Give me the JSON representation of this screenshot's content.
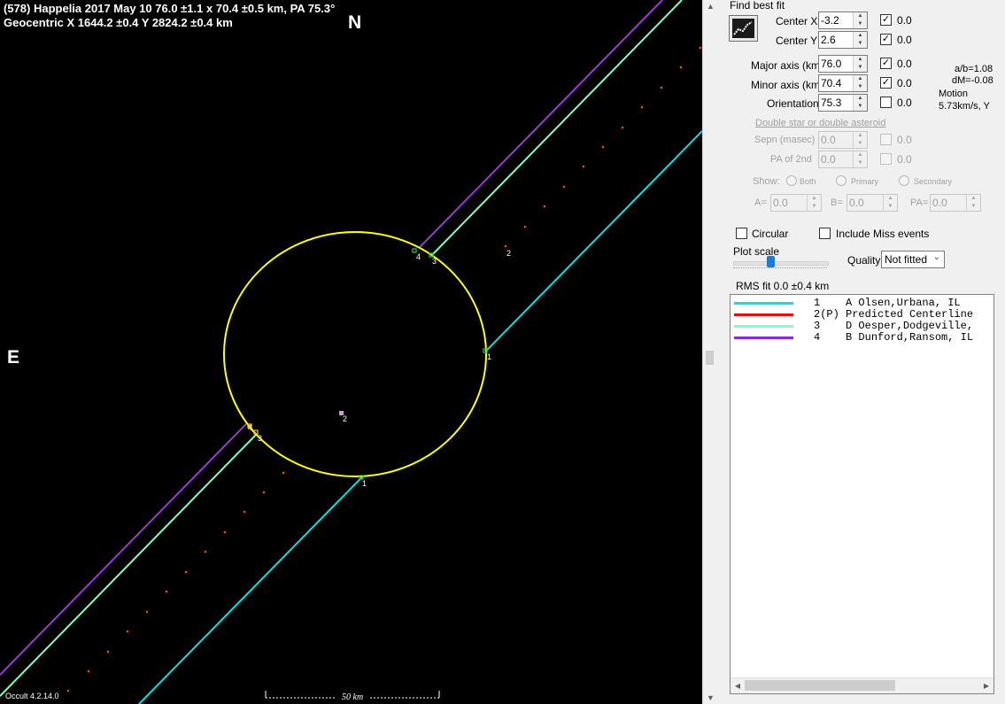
{
  "plot": {
    "title_line1": "(578) Happelia  2017 May 10   76.0 ±1.1 x 70.4 ±0.5 km,  PA 75.3°",
    "title_line2": "Geocentric  X  1644.2 ±0.4  Y 2824.2 ±0.4 km",
    "north_label": "N",
    "east_label": "E",
    "version": "Occult 4.2.14.0",
    "scale_label": "50 km",
    "chord_labels": [
      "1",
      "2",
      "3",
      "4"
    ],
    "colors": {
      "ellipse": "#ffff00",
      "chord1": "#00e5e5",
      "chord3": "#7fffc8",
      "chord4": "#9a3bd8",
      "predicted": "#ff3b3b"
    }
  },
  "panel": {
    "find_best_fit": "Find best fit",
    "fit_icon": "chart-fit-icon",
    "center_x": {
      "label": "Center X",
      "value": "-3.2",
      "checked": true,
      "uncertainty": "0.0"
    },
    "center_y": {
      "label": "Center Y",
      "value": "2.6",
      "checked": true,
      "uncertainty": "0.0"
    },
    "major_axis": {
      "label": "Major axis (km)",
      "value": "76.0",
      "checked": true,
      "uncertainty": "0.0"
    },
    "minor_axis": {
      "label": "Minor axis (km)",
      "value": "70.4",
      "checked": true,
      "uncertainty": "0.0"
    },
    "orientation": {
      "label": "Orientation",
      "value": "75.3",
      "checked": false,
      "uncertainty": "0.0"
    },
    "ab_ratio": "a/b=1.08",
    "dm": "dM=-0.08",
    "motion_label": "Motion",
    "motion_value": "5.73km/s, Y",
    "double_star_link": "Double star  or  double asteroid",
    "sepn": {
      "label": "Sepn (masec)",
      "value": "0.0",
      "uncertainty": "0.0"
    },
    "pa2nd": {
      "label": "PA of 2nd",
      "value": "0.0",
      "uncertainty": "0.0"
    },
    "show_label": "Show:",
    "show_options": [
      "Both",
      "Primary",
      "Secondary"
    ],
    "a_label": "A=",
    "a_value": "0.0",
    "b_label": "B=",
    "b_value": "0.0",
    "pa_label": "PA=",
    "pa_value": "0.0",
    "circular_label": "Circular",
    "include_miss_label": "Include Miss events",
    "plot_scale_label": "Plot scale",
    "quality_label": "Quality",
    "quality_value": "Not fitted",
    "rms_fit": "RMS fit 0.0 ±0.4 km"
  },
  "legend": [
    {
      "num": "1",
      "text": "A Olsen,Urbana, IL",
      "color": "#00e5e5"
    },
    {
      "num": "2(P)",
      "text": "Predicted Centerline",
      "color": "#ff0000"
    },
    {
      "num": "3",
      "text": "D Oesper,Dodgeville,",
      "color": "#7fffc8"
    },
    {
      "num": "4",
      "text": "B Dunford,Ransom, IL",
      "color": "#8a2be2"
    }
  ]
}
